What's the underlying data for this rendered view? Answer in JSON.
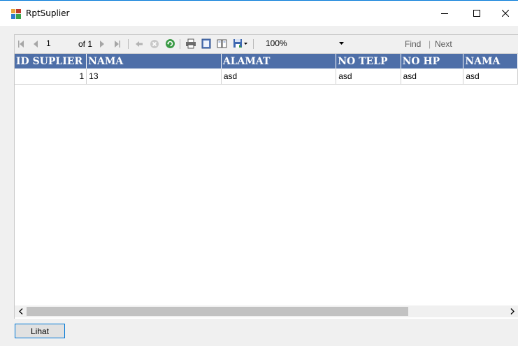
{
  "window": {
    "title": "RptSuplier"
  },
  "toolbar": {
    "current_page": "1",
    "of_label": "of 1",
    "zoom": "100%",
    "find_label": "Find",
    "find_separator": "|",
    "next_label": "Next"
  },
  "report": {
    "columns": [
      "ID SUPLIER",
      "NAMA",
      "ALAMAT",
      "NO TELP",
      "NO HP",
      "NAMA"
    ],
    "rows": [
      [
        "1",
        "13",
        "asd",
        "asd",
        "asd",
        "asd"
      ]
    ]
  },
  "actions": {
    "lihat_label": "Lihat"
  }
}
